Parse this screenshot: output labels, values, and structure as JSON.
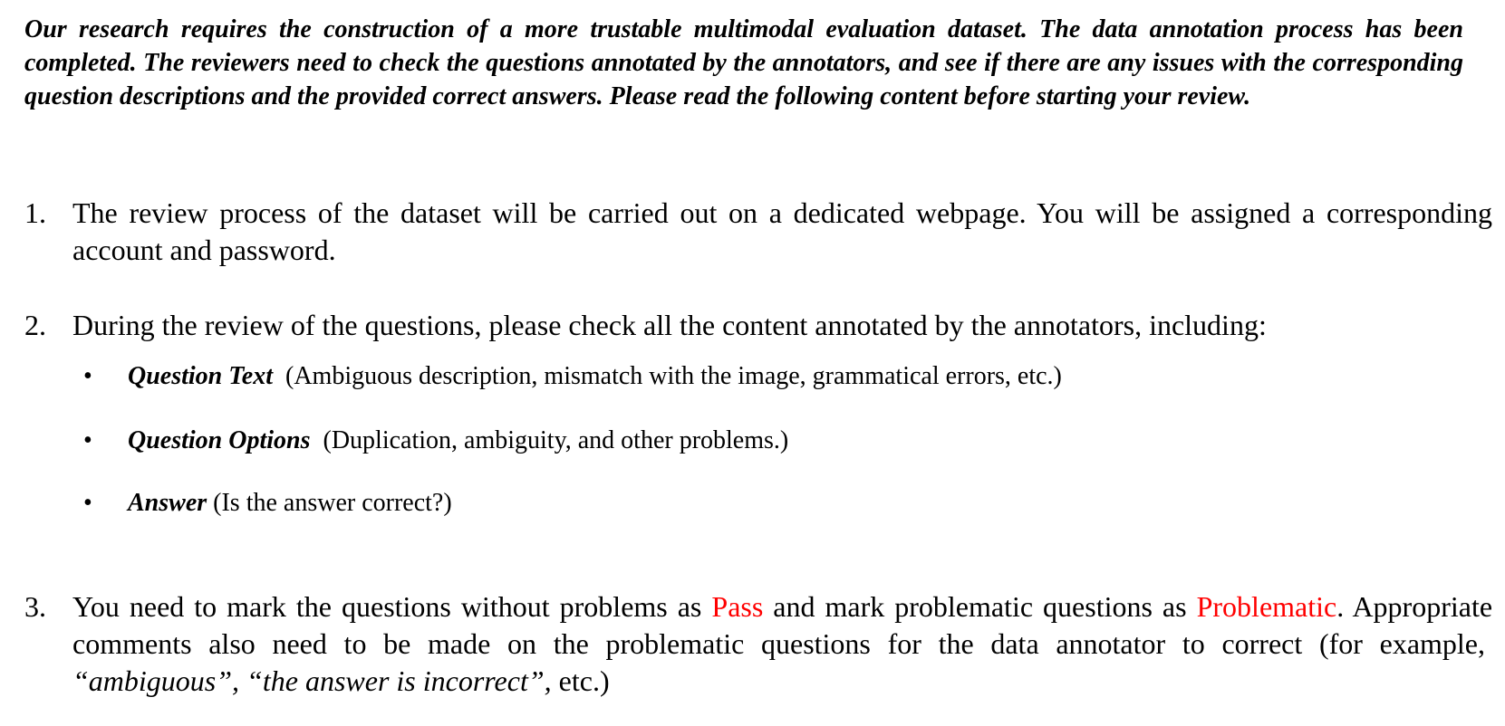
{
  "intro": "Our research requires the construction of a more trustable multimodal evaluation dataset. The data annotation process has been completed. The reviewers need to check the questions annotated by the annotators, and see if there are any issues with the corresponding question descriptions and the provided correct answers. Please read the following content before starting your review.",
  "items": [
    {
      "number": "1.",
      "text": "The review process of the dataset will be carried out on a dedicated webpage. You will be assigned a corresponding account and password."
    },
    {
      "number": "2.",
      "text": "During the review of the questions, please check all the content annotated by the annotators, including:",
      "bullets": [
        {
          "marker": "•",
          "term": "Question Text",
          "desc": "(Ambiguous description, mismatch with the image, grammatical errors, etc.)"
        },
        {
          "marker": "•",
          "term": "Question Options",
          "desc": "(Duplication, ambiguity, and other problems.)"
        },
        {
          "marker": "•",
          "term": "Answer",
          "desc": "(Is the answer correct?)"
        }
      ]
    },
    {
      "number": "3.",
      "text_before_pass": "You need to mark the questions without problems as",
      "pass_label": "Pass",
      "text_between": "and mark problematic questions as",
      "problematic_label": "Problematic",
      "text_after": ". Appropriate comments also need to be made on the problematic questions for the data annotator to correct (for example,",
      "examples": "“ambiguous”, “the answer is incorrect”,",
      "text_end": "etc.)"
    }
  ],
  "colors": {
    "highlight": "#ff0000",
    "text": "#000000"
  }
}
